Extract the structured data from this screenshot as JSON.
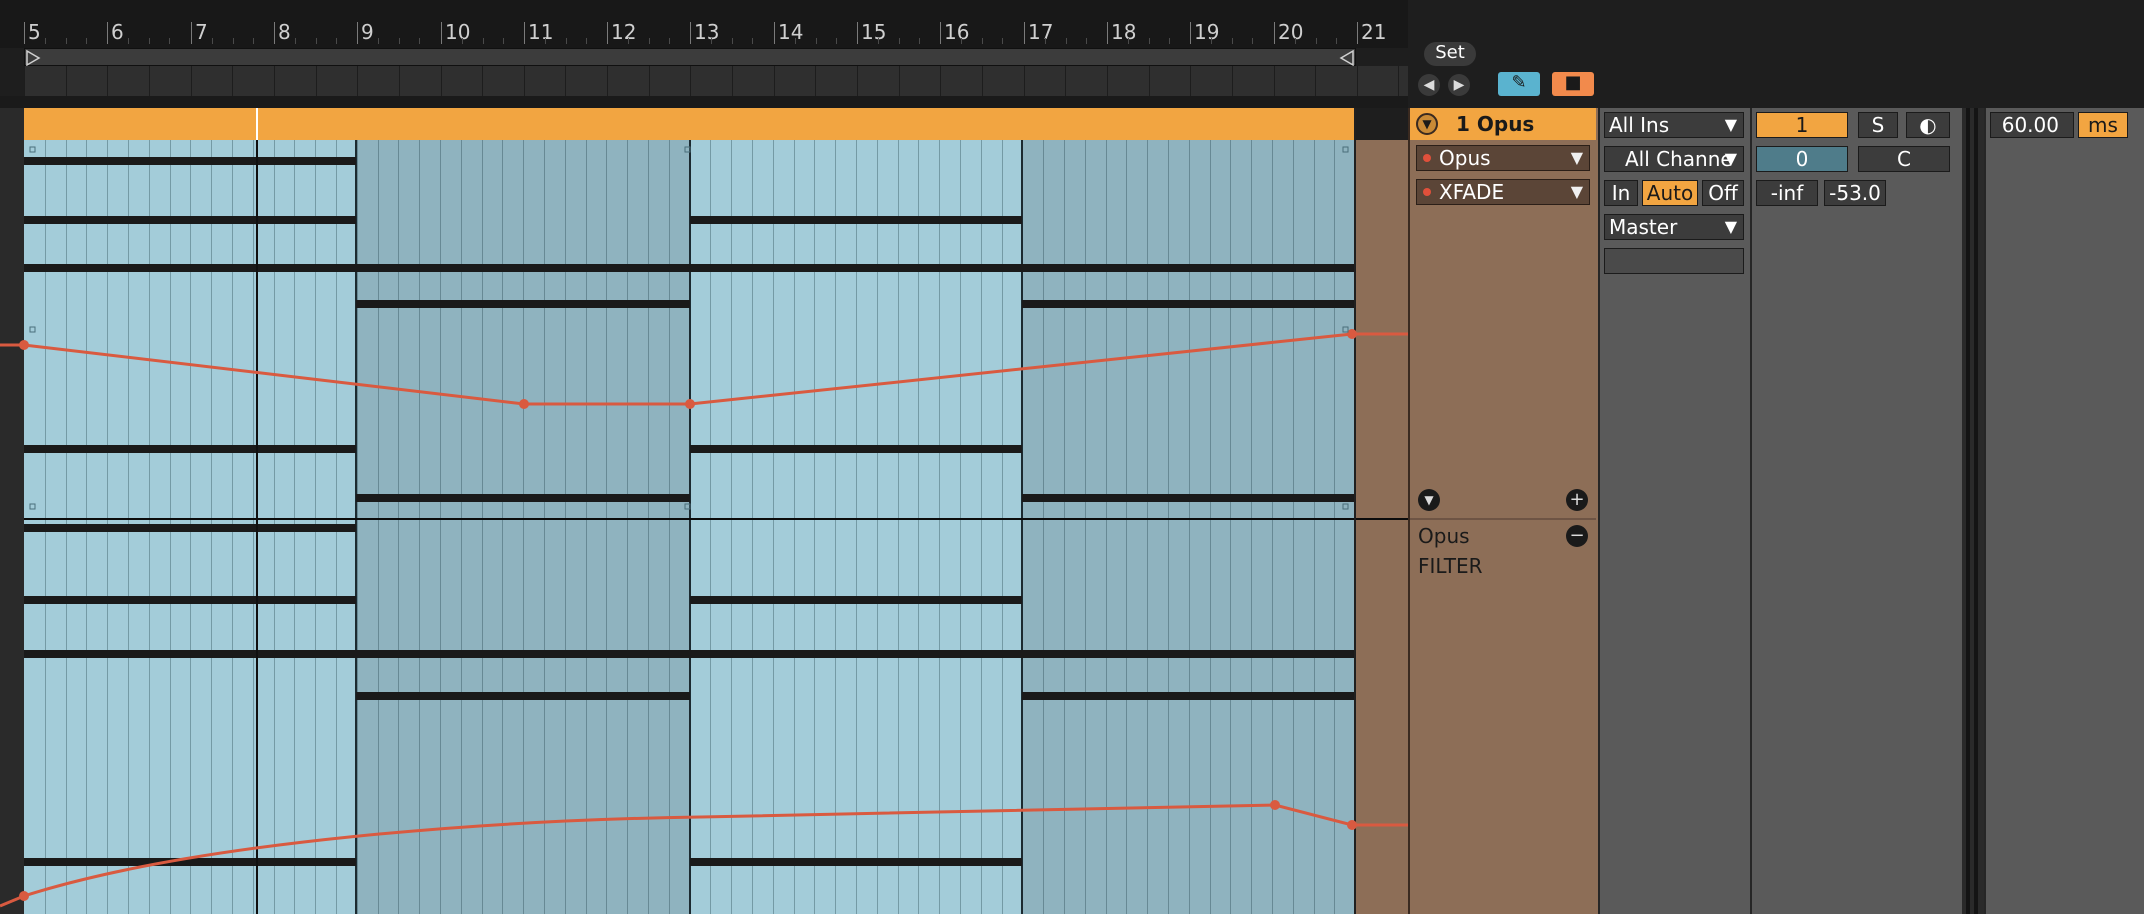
{
  "ruler": {
    "bars": [
      "5",
      "6",
      "7",
      "8",
      "9",
      "10",
      "11",
      "12",
      "13",
      "14",
      "15",
      "16",
      "17",
      "18",
      "19",
      "20",
      "21"
    ]
  },
  "top_controls": {
    "set_label": "Set",
    "back_icon": "arrow-left-icon",
    "forward_icon": "arrow-right-icon",
    "draw_icon": "pencil-icon",
    "lock_icon": "lock-icon"
  },
  "track": {
    "title": "1 Opus",
    "device_label": "Opus",
    "parameter_label": "XFADE",
    "lane2_device": "Opus",
    "lane2_parameter": "FILTER"
  },
  "io": {
    "input_type": "All Ins",
    "input_channel": "All Channe",
    "monitor": {
      "in": "In",
      "auto": "Auto",
      "off": "Off",
      "active": "Auto"
    },
    "output": "Master",
    "output_sub": ""
  },
  "mixer": {
    "track_number": "1",
    "solo": "S",
    "volume": "0",
    "pan": "C",
    "peak_left": "-inf",
    "peak_right": "-53.0"
  },
  "delay": {
    "value": "60.00",
    "unit": "ms"
  },
  "colors": {
    "clip_header": "#f2a541",
    "clip_body_light": "#a3ccd9",
    "clip_body_dark": "#8fb3bf",
    "automation": "#d95a40",
    "track_panel": "#8d6e57",
    "accent_blue": "#5ab3cf",
    "accent_orange": "#f28a4c"
  }
}
